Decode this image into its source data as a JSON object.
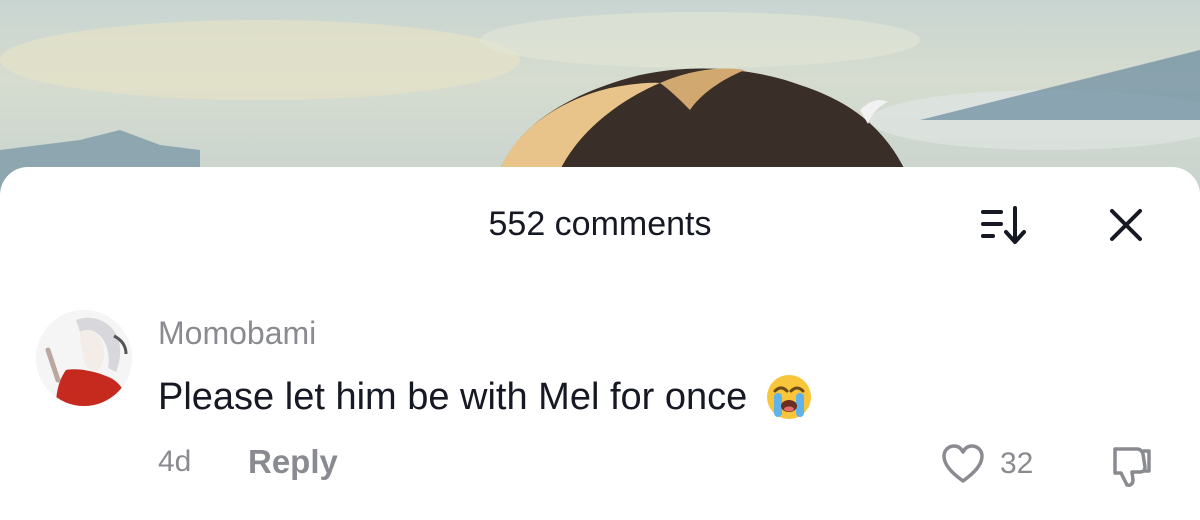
{
  "video": {
    "sky_color": "#c9d5d2",
    "hair_light": "#e8c48a",
    "hair_dark": "#3a2e28"
  },
  "comments_sheet": {
    "title": "552 comments",
    "sort_icon": "sort-icon",
    "close_icon": "close-icon"
  },
  "comment": {
    "username": "Momobami",
    "text": "Please let him be with Mel for once",
    "emoji": "loudly-crying-face",
    "time": "4d",
    "reply_label": "Reply",
    "like_count": "32",
    "like_icon": "heart-icon",
    "dislike_icon": "thumbs-down-icon"
  },
  "colors": {
    "text_primary": "#161823",
    "text_secondary": "#8a8b91",
    "sheet_bg": "#ffffff"
  }
}
